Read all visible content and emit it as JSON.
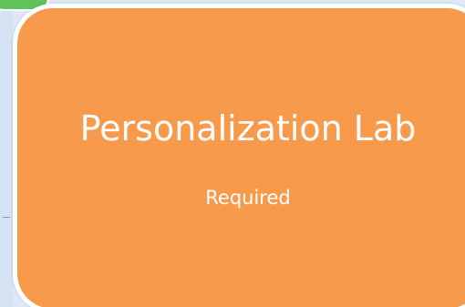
{
  "card": {
    "title": "Personalization Lab",
    "status": "Required"
  },
  "colors": {
    "card_fill": "#f79a4b",
    "card_border": "#ffffff",
    "background": "#dde9f6",
    "tab_accent": "#62c25a"
  }
}
